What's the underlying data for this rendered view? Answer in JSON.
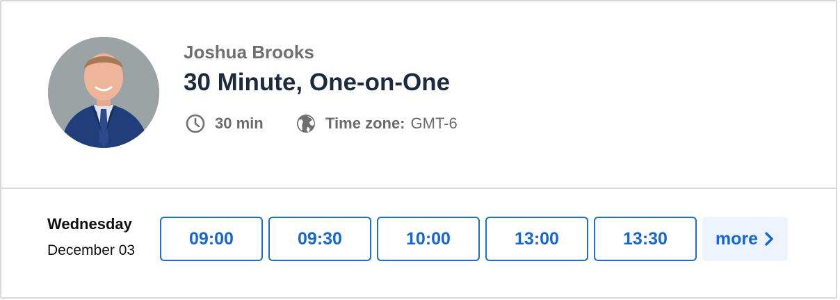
{
  "host": {
    "name": "Joshua Brooks",
    "avatar_icon": "host-avatar-photo"
  },
  "event": {
    "title": "30 Minute, One-on-One",
    "duration": "30 min",
    "timezone_label": "Time zone:",
    "timezone_value": "GMT-6"
  },
  "icons": {
    "duration": "clock-icon",
    "timezone": "globe-icon",
    "more": "chevron-right-icon"
  },
  "schedule": {
    "weekday": "Wednesday",
    "date": "December 03",
    "slots": [
      "09:00",
      "09:30",
      "10:00",
      "13:00",
      "13:30"
    ],
    "more_label": "more"
  },
  "colors": {
    "accent": "#1267d6",
    "title": "#1a2b40",
    "muted": "#6f6f6f",
    "more_bg": "#eef4fd"
  }
}
